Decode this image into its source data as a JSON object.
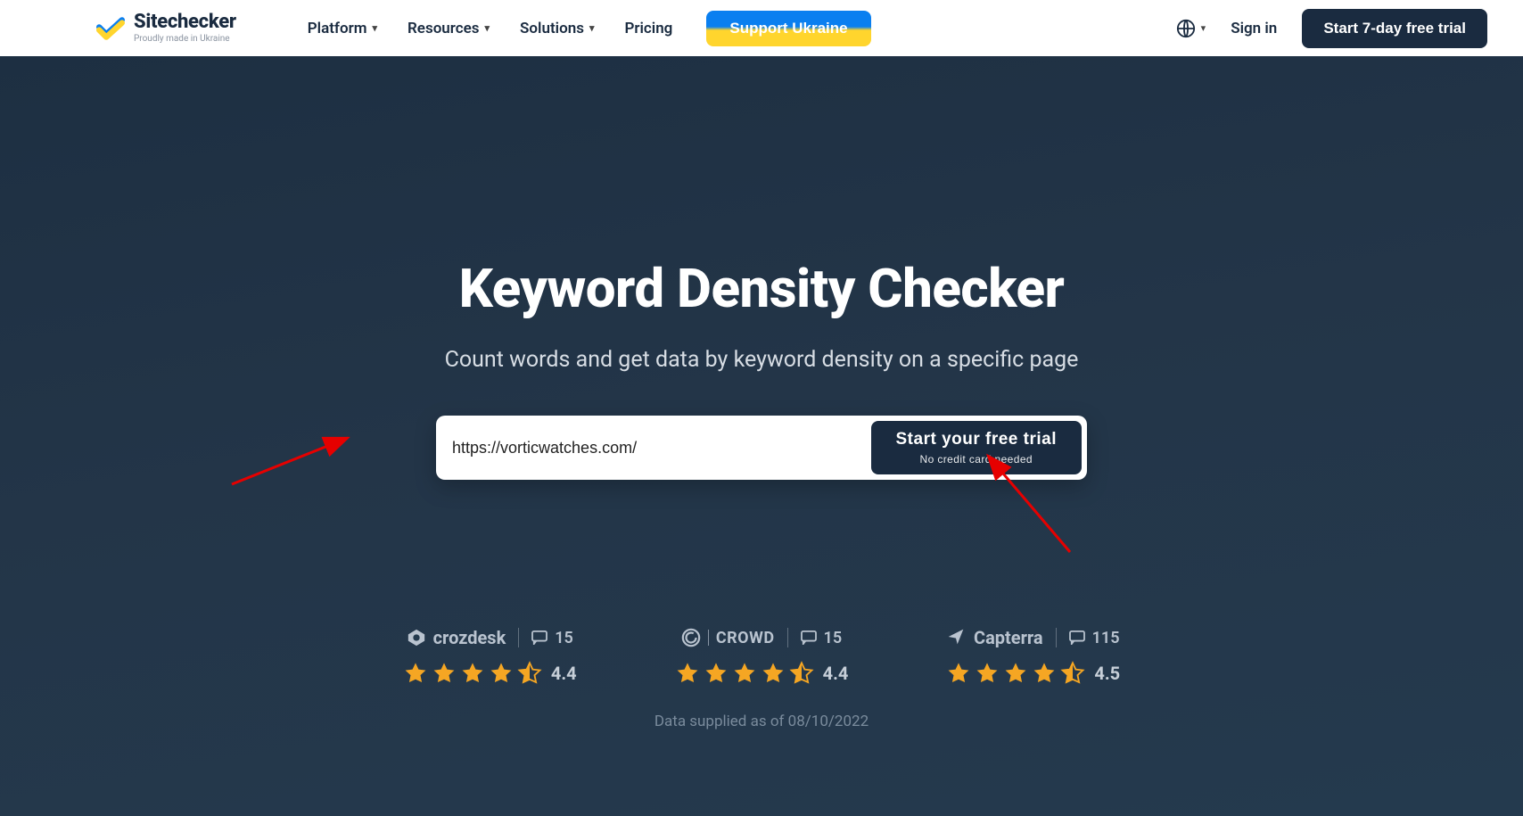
{
  "header": {
    "logo": {
      "title": "Sitechecker",
      "subtitle": "Proudly made in Ukraine"
    },
    "nav": [
      {
        "label": "Platform",
        "dropdown": true
      },
      {
        "label": "Resources",
        "dropdown": true
      },
      {
        "label": "Solutions",
        "dropdown": true
      },
      {
        "label": "Pricing",
        "dropdown": false
      }
    ],
    "support_label": "Support Ukraine",
    "signin_label": "Sign in",
    "trial_label": "Start 7-day free trial"
  },
  "hero": {
    "title": "Keyword Density Checker",
    "subtitle": "Count words and get data by keyword density on a specific page",
    "input_value": "https://vorticwatches.com/",
    "cta_title": "Start your free trial",
    "cta_sub": "No credit card needed"
  },
  "ratings": [
    {
      "brand": "crozdesk",
      "reviews": "15",
      "score": "4.4",
      "full": 4,
      "half": true
    },
    {
      "brand": "CROWD",
      "reviews": "15",
      "score": "4.4",
      "full": 4,
      "half": true
    },
    {
      "brand": "Capterra",
      "reviews": "115",
      "score": "4.5",
      "full": 4,
      "half": true
    }
  ],
  "supplied": "Data supplied as of 08/10/2022"
}
